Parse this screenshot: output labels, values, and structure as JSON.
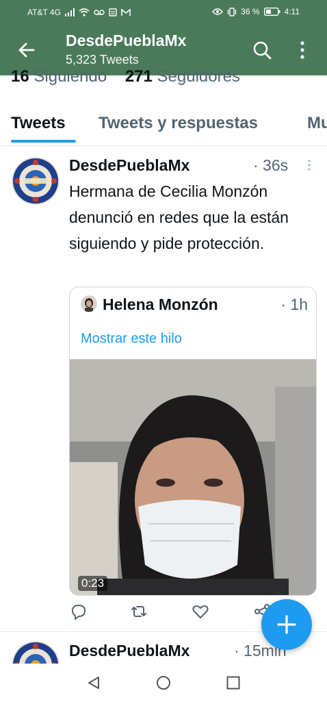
{
  "status_bar": {
    "carrier": "AT&T 4G",
    "battery": "36 %",
    "time": "4:11"
  },
  "header": {
    "title": "DesdePueblaMx",
    "subtitle": "5,323 Tweets",
    "back_icon": "arrow-left-icon",
    "search_icon": "search-icon",
    "more_icon": "more-vertical-icon"
  },
  "profile": {
    "following_count": "16",
    "following_label": "Siguiendo",
    "followers_count": "271",
    "followers_label": "Seguidores"
  },
  "tabs": [
    {
      "label": "Tweets",
      "active": true
    },
    {
      "label": "Tweets y respuestas",
      "active": false
    },
    {
      "label": "Mu",
      "active": false
    }
  ],
  "tweets": [
    {
      "author": "DesdePueblaMx",
      "time": "· 36s",
      "text": "Hermana de Cecilia Monzón denunció en redes que la están siguiendo y pide protección.",
      "quote": {
        "author": "Helena Monzón",
        "time": "· 1h",
        "link": "Mostrar este hilo",
        "video_duration": "0:23"
      }
    },
    {
      "author": "DesdePueblaMx",
      "time": "· 15min"
    }
  ],
  "colors": {
    "header_bg": "#4a7a5a",
    "accent": "#1d9bf0",
    "text": "#0f1419",
    "secondary": "#536471"
  }
}
